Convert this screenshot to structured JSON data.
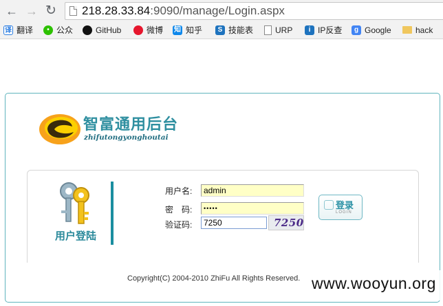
{
  "browser": {
    "url_host": "218.28.33.84",
    "url_rest": ":9090/manage/Login.aspx"
  },
  "bookmarks": [
    {
      "label": "翻译",
      "icon": "translate-icon",
      "color": "#2b7de1"
    },
    {
      "label": "公众",
      "icon": "wechat-icon",
      "color": "#2dc100"
    },
    {
      "label": "GitHub",
      "icon": "github-icon",
      "color": "#111111"
    },
    {
      "label": "微博",
      "icon": "weibo-icon",
      "color": "#e6162d"
    },
    {
      "label": "知乎",
      "icon": "zhihu-icon",
      "color": "#0f88eb"
    },
    {
      "label": "技能表",
      "icon": "s-icon",
      "color": "#1e73be"
    },
    {
      "label": "URP",
      "icon": "page-icon",
      "color": "#ffffff"
    },
    {
      "label": "IP反查",
      "icon": "ip-icon",
      "color": "#1e73be"
    },
    {
      "label": "Google",
      "icon": "google-icon",
      "color": "#4285f4"
    },
    {
      "label": "hack",
      "icon": "folder-icon",
      "color": "#f0c75e"
    }
  ],
  "brand": {
    "title": "智富通用后台",
    "subtitle": "zhifutongyonghoutai"
  },
  "login": {
    "panel_label": "用户登陆",
    "username_label": "用户名:",
    "username_value": "admin",
    "password_label": "密　码:",
    "password_value": "•••••",
    "captcha_label": "验证码:",
    "captcha_value": "7250",
    "captcha_image_text": "7250",
    "button_label_cn": "登录",
    "button_label_en": "LOGIN"
  },
  "footer": {
    "copyright": "Copyright(C) 2004-2010 ZhiFu All Rights Reserved."
  },
  "watermark": "www.wooyun.org"
}
